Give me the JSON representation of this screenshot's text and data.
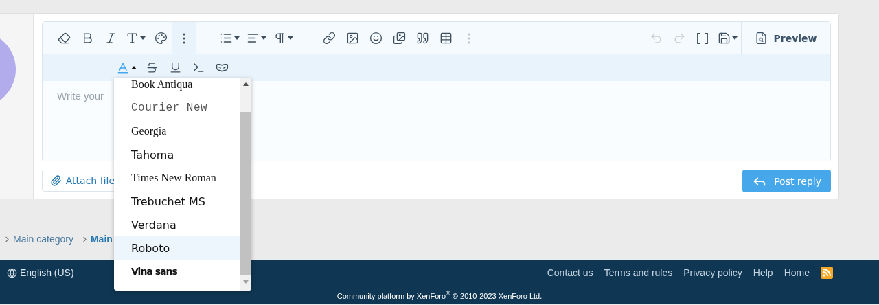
{
  "editor": {
    "toolbar": {
      "more_expanded": true,
      "undo_disabled": true,
      "redo_disabled": true,
      "preview": "Preview"
    },
    "font_button": {
      "expanded": true
    },
    "placeholder": "Write your"
  },
  "font_menu": {
    "items": [
      {
        "label": "Book Antiqua",
        "kind": "serif",
        "selected": false
      },
      {
        "label": "Courier New",
        "kind": "mono",
        "selected": false
      },
      {
        "label": "Georgia",
        "kind": "serif",
        "selected": false
      },
      {
        "label": "Tahoma",
        "kind": "sans",
        "selected": false
      },
      {
        "label": "Times New Roman",
        "kind": "serif",
        "selected": false
      },
      {
        "label": "Trebuchet MS",
        "kind": "sans",
        "selected": false
      },
      {
        "label": "Verdana",
        "kind": "sans",
        "selected": false
      },
      {
        "label": "Roboto",
        "kind": "sans",
        "selected": true
      },
      {
        "label": "Vina sans",
        "kind": "condensed",
        "selected": false
      }
    ]
  },
  "actions": {
    "attach": "Attach file",
    "submit": "Post reply"
  },
  "breadcrumb": [
    {
      "label": "Main category",
      "current": false
    },
    {
      "label": "Main",
      "current": true
    }
  ],
  "footer": {
    "language": "English (US)",
    "links": [
      "Contact us",
      "Terms and rules",
      "Privacy policy",
      "Help",
      "Home"
    ],
    "copyright": "Community platform by XenForo$^{®}$ © 2010-2023 XenForo Ltd."
  }
}
